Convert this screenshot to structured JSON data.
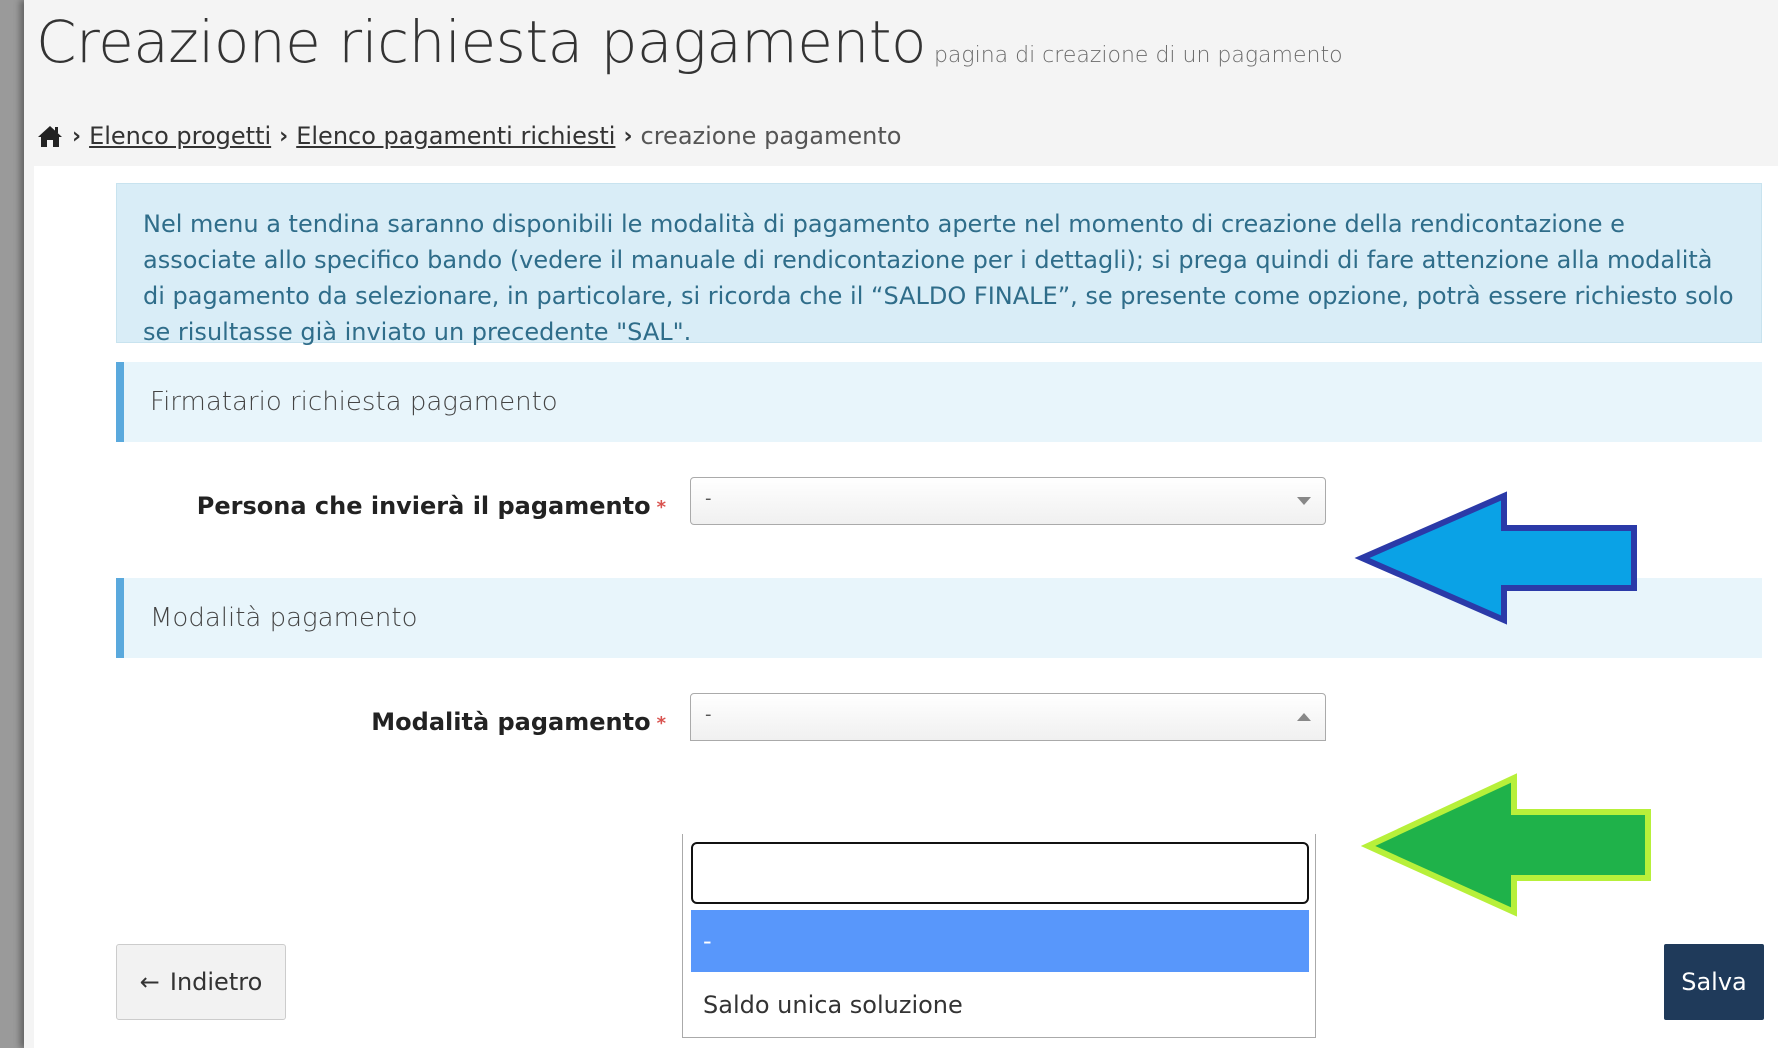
{
  "header": {
    "title": "Creazione richiesta pagamento",
    "subtitle": "pagina di creazione di un pagamento"
  },
  "breadcrumb": {
    "items": [
      "Elenco progetti",
      "Elenco pagamenti richiesti"
    ],
    "current": "creazione pagamento"
  },
  "alert": {
    "text": "Nel menu a tendina saranno disponibili le modalità di pagamento aperte nel momento di creazione della rendicontazione e associate allo specifico bando (vedere il manuale di rendicontazione per i dettagli); si prega quindi di fare attenzione alla modalità di pagamento da selezionare, in particolare, si ricorda che il “SALDO FINALE”, se presente come opzione, potrà essere richiesto solo se risultasse già inviato un precedente \"SAL\"."
  },
  "section_firmatario": {
    "title": "Firmatario richiesta pagamento",
    "field_label": "Persona che invierà il pagamento",
    "required_mark": "*",
    "selected_value": "-"
  },
  "section_modalita": {
    "title": "Modalità pagamento",
    "field_label": "Modalità pagamento",
    "required_mark": "*",
    "selected_value": "-",
    "options": [
      "-",
      "Saldo unica soluzione"
    ],
    "search_value": ""
  },
  "buttons": {
    "back_label": "Indietro",
    "save_label": "Salva"
  },
  "colors": {
    "alert_bg": "#d9edf7",
    "section_accent": "#5aa9dd",
    "selected_option": "#5897fb",
    "save_button": "#1f3a5a",
    "arrow_blue": "#0aa2e6",
    "arrow_green": "#1fb24a"
  },
  "icons": [
    "home-icon",
    "chevron-right-icon",
    "caret-down-icon",
    "caret-up-icon",
    "arrow-left-icon"
  ]
}
